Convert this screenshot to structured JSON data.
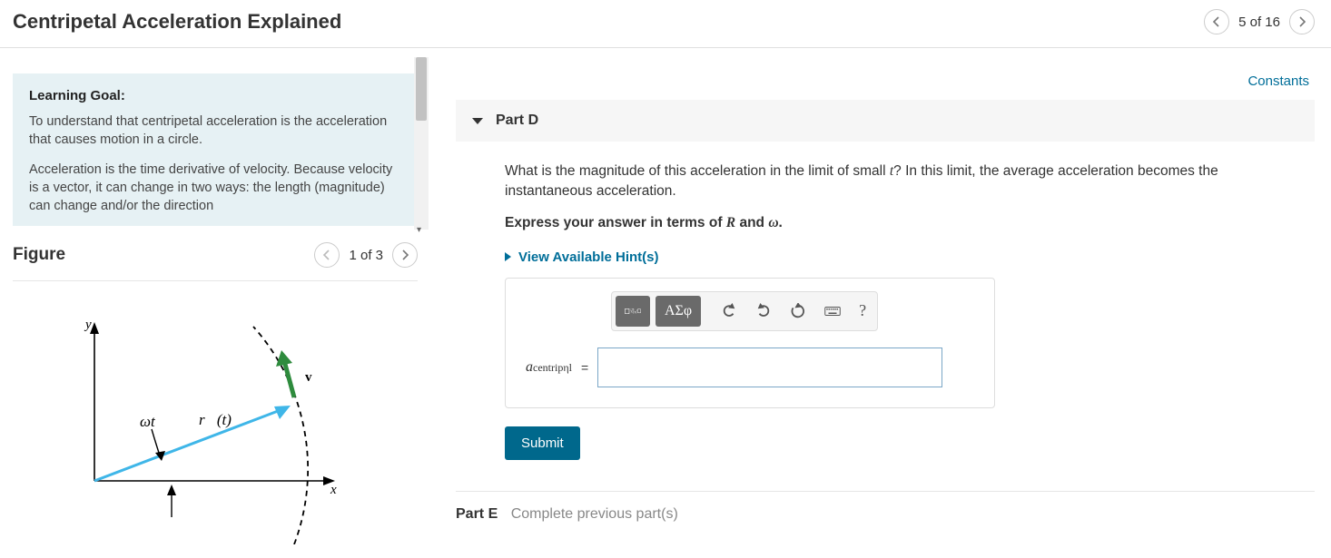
{
  "header": {
    "title": "Centripetal Acceleration Explained",
    "page_current": 5,
    "page_total": 16,
    "pager_text": "5 of 16"
  },
  "goal": {
    "heading": "Learning Goal:",
    "p1": "To understand that centripetal acceleration is the acceleration that causes motion in a circle.",
    "p2": "Acceleration is the time derivative of velocity. Because velocity is a vector, it can change in two ways: the length (magnitude) can change and/or the direction"
  },
  "figure": {
    "title": "Figure",
    "pager_text": "1 of 3",
    "labels": {
      "y": "y",
      "x": "x",
      "v": "v",
      "omega_t": "ωt",
      "r_t": "r⃗(t)"
    }
  },
  "links": {
    "constants": "Constants"
  },
  "partD": {
    "label": "Part D",
    "question_prefix": "What is the magnitude of this acceleration in the limit of small ",
    "question_var": "t",
    "question_suffix": "? In this limit, the average acceleration becomes the instantaneous acceleration.",
    "instruction_prefix": "Express your answer in terms of ",
    "var_R": "R",
    "instruction_mid": " and ",
    "var_omega": "ω",
    "instruction_end": ".",
    "hints_label": "View Available Hint(s)",
    "toolbar": {
      "greek": "ΑΣφ"
    },
    "lhs_a": "a",
    "lhs_sub": "centripηl",
    "equals": "=",
    "submit": "Submit"
  },
  "partE": {
    "label": "Part E",
    "message": "Complete previous part(s)"
  }
}
